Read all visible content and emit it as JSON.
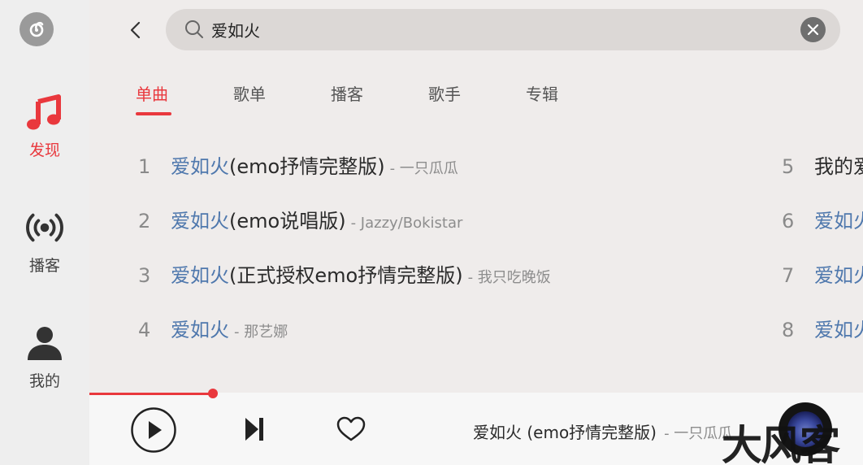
{
  "app": {
    "accent_color": "#e9383d",
    "link_color": "#4f78ad"
  },
  "sidebar": {
    "logo_icon": "netease-music-logo-icon",
    "items": [
      {
        "label": "发现",
        "icon": "music-note-icon",
        "active": true
      },
      {
        "label": "播客",
        "icon": "broadcast-icon",
        "active": false
      },
      {
        "label": "我的",
        "icon": "person-icon",
        "active": false
      }
    ]
  },
  "search": {
    "value": "爱如火",
    "placeholder": ""
  },
  "tabs": [
    {
      "label": "单曲",
      "active": true
    },
    {
      "label": "歌单",
      "active": false
    },
    {
      "label": "播客",
      "active": false
    },
    {
      "label": "歌手",
      "active": false
    },
    {
      "label": "专辑",
      "active": false
    }
  ],
  "results": [
    {
      "index": "1",
      "highlight": "爱如火",
      "rest": " (emo抒情完整版)",
      "artist": "- 一只瓜瓜"
    },
    {
      "index": "2",
      "highlight": "爱如火",
      "rest": " (emo说唱版)",
      "artist": "- Jazzy/Bokistar"
    },
    {
      "index": "3",
      "highlight": "爱如火",
      "rest": " (正式授权emo抒情完整版)",
      "artist": "- 我只吃晚饭"
    },
    {
      "index": "4",
      "highlight": "爱如火",
      "rest": "",
      "artist": "- 那艺娜"
    },
    {
      "index": "5",
      "highlight": "",
      "rest": "我的爱",
      "artist": ""
    },
    {
      "index": "6",
      "highlight": "爱如火",
      "rest": "",
      "artist": ""
    },
    {
      "index": "7",
      "highlight": "爱如火",
      "rest": "",
      "artist": ""
    },
    {
      "index": "8",
      "highlight": "爱如火",
      "rest": "",
      "artist": ""
    }
  ],
  "player": {
    "progress": 0.16,
    "title": "爱如火 (emo抒情完整版)",
    "artist": "- 一只瓜瓜"
  },
  "watermark": {
    "text": "大风客"
  }
}
